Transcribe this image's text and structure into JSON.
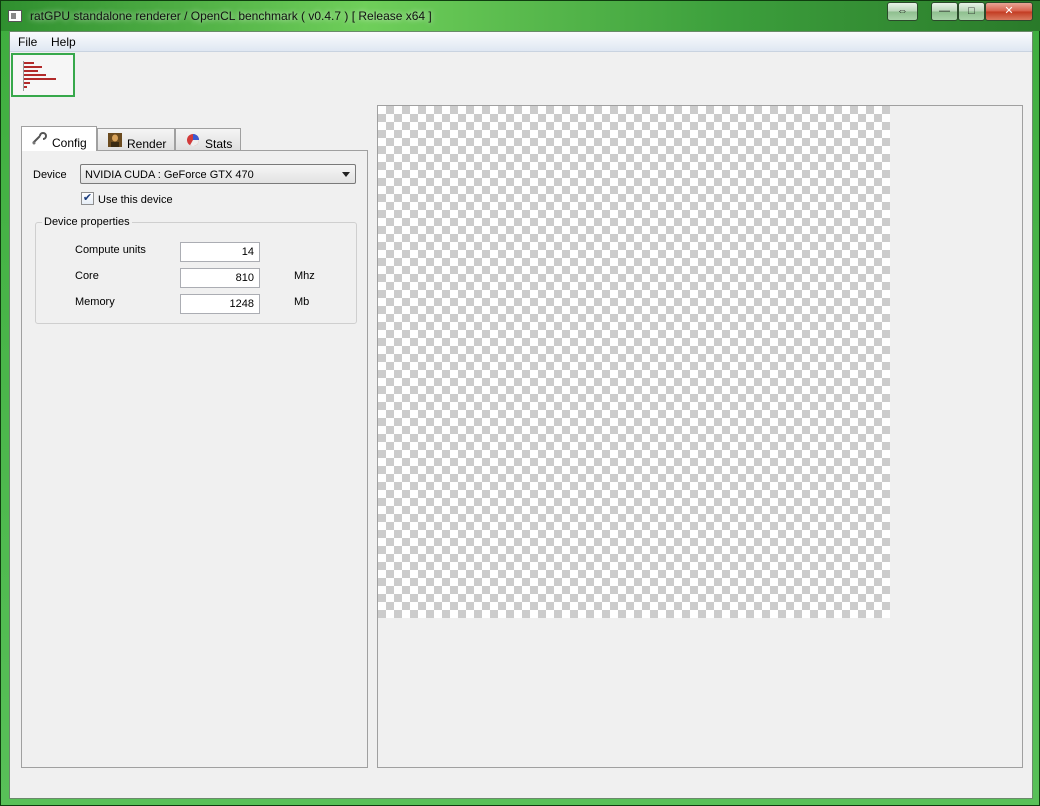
{
  "window": {
    "title": "ratGPU standalone renderer / OpenCL benchmark ( v0.4.7 ) [ Release x64 ]",
    "caption_buttons": {
      "restore_alt": "⇔",
      "minimize": "—",
      "maximize": "□",
      "close": "✕"
    },
    "accent_color": "#37a84b"
  },
  "menu": {
    "file": "File",
    "help": "Help"
  },
  "tabs": {
    "config": "Config",
    "render": "Render",
    "stats": "Stats"
  },
  "config": {
    "device_label": "Device",
    "device_value": "NVIDIA CUDA : GeForce GTX 470",
    "use_device_label": "Use this device",
    "use_device_checked": true,
    "properties_title": "Device properties",
    "properties": {
      "compute_units": {
        "label": "Compute units",
        "value": "14",
        "unit": ""
      },
      "core": {
        "label": "Core",
        "value": "810",
        "unit": "Mhz"
      },
      "memory": {
        "label": "Memory",
        "value": "1248",
        "unit": "Mb"
      }
    }
  }
}
